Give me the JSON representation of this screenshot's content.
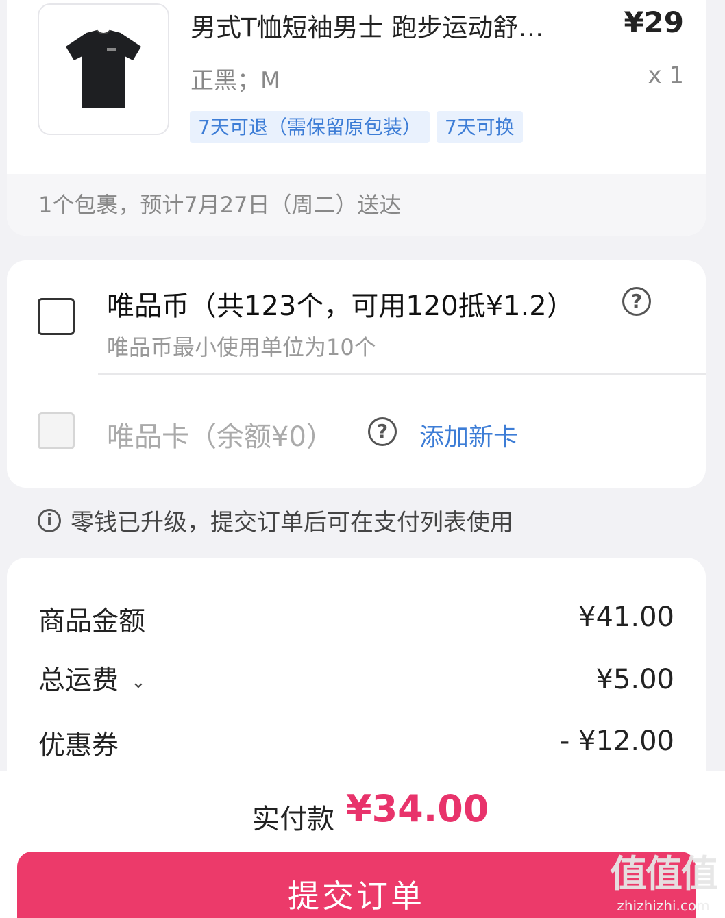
{
  "product": {
    "title": "男式T恤短袖男士 跑步运动舒…",
    "price": "¥29",
    "spec": "正黑；M",
    "qty": "x 1",
    "tags": [
      "7天可退（需保留原包装）",
      "7天可换"
    ],
    "delivery": "1个包裹，预计7月27日（周二）送达"
  },
  "wallet": {
    "coin_title": "唯品币（共123个，可用120抵¥1.2）",
    "coin_sub": "唯品币最小使用单位为10个",
    "card_title": "唯品卡（余额¥0）",
    "add_card": "添加新卡",
    "help_glyph": "?"
  },
  "notice": {
    "icon": "info-icon",
    "text": "零钱已升级，提交订单后可在支付列表使用"
  },
  "summary": {
    "goods_label": "商品金额",
    "goods_value": "¥41.00",
    "shipping_label": "总运费",
    "shipping_value": "¥5.00",
    "coupon_label": "优惠券",
    "coupon_value": "- ¥12.00"
  },
  "bottom": {
    "pay_label": "实付款",
    "pay_amount": "¥34.00",
    "submit_label": "提交订单"
  },
  "watermark": {
    "logo": "值值值",
    "site": "zhizhizhi.com"
  },
  "colors": {
    "accent": "#ec3a6a",
    "link": "#3d7dd6",
    "price_red": "#e8336b"
  }
}
